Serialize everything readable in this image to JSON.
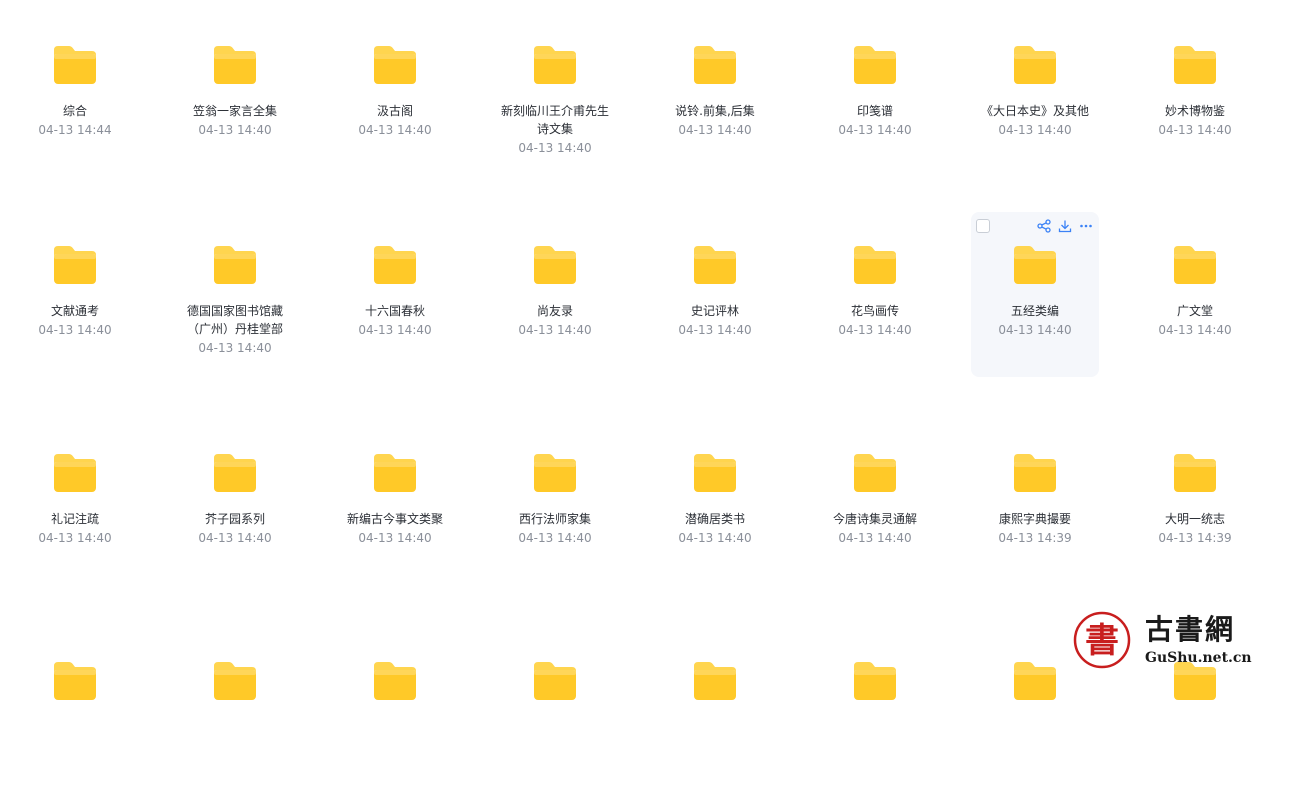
{
  "rows": [
    [
      {
        "name": "综合",
        "time": "04-13 14:44"
      },
      {
        "name": "笠翁一家言全集",
        "time": "04-13 14:40"
      },
      {
        "name": "汲古阁",
        "time": "04-13 14:40"
      },
      {
        "name": "新刻临川王介甫先生诗文集",
        "time": "04-13 14:40"
      },
      {
        "name": "说铃.前集,后集",
        "time": "04-13 14:40"
      },
      {
        "name": "印笺谱",
        "time": "04-13 14:40"
      },
      {
        "name": "《大日本史》及其他",
        "time": "04-13 14:40"
      },
      {
        "name": "妙术博物鉴",
        "time": "04-13 14:40"
      }
    ],
    [
      {
        "name": "文献通考",
        "time": "04-13 14:40"
      },
      {
        "name": "德国国家图书馆藏（广州）丹桂堂部",
        "time": "04-13 14:40"
      },
      {
        "name": "十六国春秋",
        "time": "04-13 14:40"
      },
      {
        "name": "尚友录",
        "time": "04-13 14:40"
      },
      {
        "name": "史记评林",
        "time": "04-13 14:40"
      },
      {
        "name": "花鸟画传",
        "time": "04-13 14:40"
      },
      {
        "name": "五经类编",
        "time": "04-13 14:40"
      },
      {
        "name": "广文堂",
        "time": "04-13 14:40"
      }
    ],
    [
      {
        "name": "礼记注疏",
        "time": "04-13 14:40"
      },
      {
        "name": "芥子园系列",
        "time": "04-13 14:40"
      },
      {
        "name": "新编古今事文类聚",
        "time": "04-13 14:40"
      },
      {
        "name": "西行法师家集",
        "time": "04-13 14:40"
      },
      {
        "name": "潜确居类书",
        "time": "04-13 14:40"
      },
      {
        "name": "今唐诗集灵通解",
        "time": "04-13 14:40"
      },
      {
        "name": "康熙字典撮要",
        "time": "04-13 14:39"
      },
      {
        "name": "大明一统志",
        "time": "04-13 14:39"
      }
    ]
  ],
  "hovered": {
    "row": 1,
    "col": 6
  },
  "icons": {
    "folder": "folder-icon",
    "checkbox": "checkbox-icon",
    "share": "share-icon",
    "download": "download-icon",
    "more": "more-icon"
  },
  "colors": {
    "folder_top": "#FFD54F",
    "folder_body": "#FFC928",
    "accent": "#3b82f6",
    "name_text": "#2b2f36",
    "time_text": "#8a8f99",
    "hover_bg": "#f5f7fb"
  },
  "watermark": {
    "seal_char": "書",
    "title": "古書網",
    "url": "GuShu.net.cn"
  }
}
